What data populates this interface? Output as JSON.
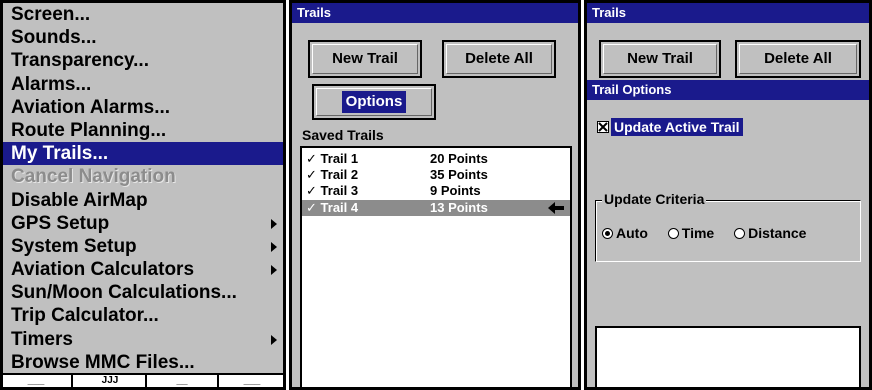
{
  "menu": {
    "items": [
      {
        "label": "Screen...",
        "state": "normal",
        "submenu": false
      },
      {
        "label": "Sounds...",
        "state": "normal",
        "submenu": false
      },
      {
        "label": "Transparency...",
        "state": "normal",
        "submenu": false
      },
      {
        "label": "Alarms...",
        "state": "normal",
        "submenu": false
      },
      {
        "label": "Aviation Alarms...",
        "state": "normal",
        "submenu": false
      },
      {
        "label": "Route Planning...",
        "state": "normal",
        "submenu": false
      },
      {
        "label": "My Trails...",
        "state": "selected",
        "submenu": false
      },
      {
        "label": "Cancel Navigation",
        "state": "disabled",
        "submenu": false
      },
      {
        "label": "Disable AirMap",
        "state": "normal",
        "submenu": false
      },
      {
        "label": "GPS Setup",
        "state": "normal",
        "submenu": true
      },
      {
        "label": "System Setup",
        "state": "normal",
        "submenu": true
      },
      {
        "label": "Aviation Calculators",
        "state": "normal",
        "submenu": true
      },
      {
        "label": "Sun/Moon Calculations...",
        "state": "normal",
        "submenu": false
      },
      {
        "label": "Trip Calculator...",
        "state": "normal",
        "submenu": false
      },
      {
        "label": "Timers",
        "state": "normal",
        "submenu": true
      },
      {
        "label": "Browse MMC Files...",
        "state": "normal",
        "submenu": false
      }
    ],
    "status_bar": [
      "___",
      "JJJ",
      "__",
      "___"
    ]
  },
  "trails_panel": {
    "title": "Trails",
    "new_trail_label": "New Trail",
    "delete_all_label": "Delete All",
    "options_label": "Options",
    "saved_label": "Saved Trails",
    "trails": [
      {
        "check": "✓",
        "name": "Trail 1",
        "points": "20 Points",
        "selected": false
      },
      {
        "check": "✓",
        "name": "Trail 2",
        "points": "35 Points",
        "selected": false
      },
      {
        "check": "✓",
        "name": "Trail 3",
        "points": "9 Points",
        "selected": false
      },
      {
        "check": "✓",
        "name": "Trail 4",
        "points": "13 Points",
        "selected": true
      }
    ]
  },
  "options_panel": {
    "title": "Trails",
    "new_trail_label": "New Trail",
    "delete_all_label": "Delete All",
    "options_title": "Trail Options",
    "update_active_label": "Update Active Trail",
    "update_active_checked": true,
    "criteria_label": "Update Criteria",
    "criteria": [
      {
        "label": "Auto",
        "selected": true
      },
      {
        "label": "Time",
        "selected": false
      },
      {
        "label": "Distance",
        "selected": false
      }
    ]
  },
  "colors": {
    "highlight": "#1a1a8c",
    "panel": "#c0c0c0",
    "disabled": "#8c8c8c"
  }
}
